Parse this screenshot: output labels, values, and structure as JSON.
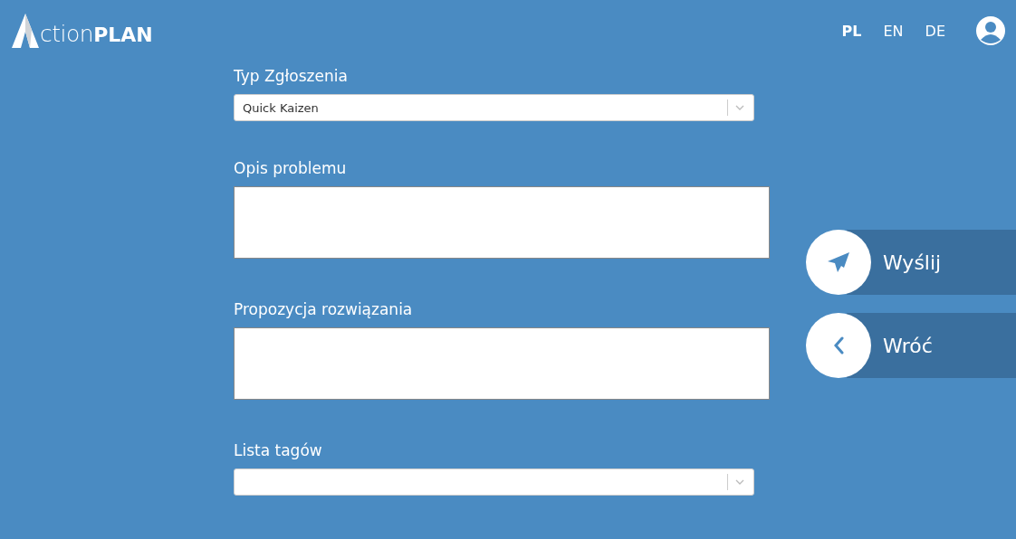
{
  "logo": {
    "light": "ction",
    "bold": "PLAN"
  },
  "languages": [
    {
      "label": "PL",
      "selected": true
    },
    {
      "label": "EN",
      "selected": false
    },
    {
      "label": "DE",
      "selected": false
    }
  ],
  "fields": [
    {
      "kind": "select",
      "label": "Typ Zgłoszenia",
      "value": "Quick Kaizen"
    },
    {
      "kind": "textarea",
      "label": "Opis problemu"
    },
    {
      "kind": "textarea",
      "label": "Propozycja rozwiązania"
    },
    {
      "kind": "select",
      "label": "Lista tagów"
    }
  ],
  "actions": [
    {
      "kind": "send",
      "label": "Wyślij"
    },
    {
      "kind": "back",
      "label": "Wróć"
    }
  ]
}
